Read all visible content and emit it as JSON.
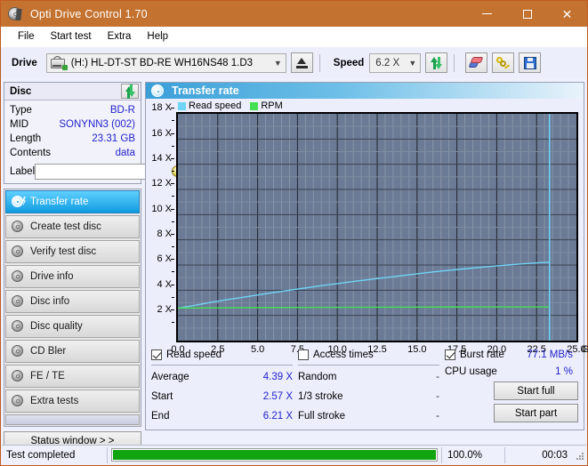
{
  "window": {
    "title": "Opti Drive Control 1.70",
    "icon": "optical-disc-icon",
    "minimize": "minimize",
    "maximize": "maximize",
    "close": "close"
  },
  "menu": {
    "items": [
      "File",
      "Start test",
      "Extra",
      "Help"
    ]
  },
  "toolbar": {
    "drive_label": "Drive",
    "drive_value": "(H:)  HL-DT-ST BD-RE  WH16NS48 1.D3",
    "eject_title": "Eject",
    "speed_label": "Speed",
    "speed_value": "6.2 X",
    "refresh_title": "Refresh",
    "erase_title": "Erase",
    "keys_title": "Keys",
    "save_title": "Save"
  },
  "disc": {
    "title": "Disc",
    "refresh_title": "Refresh disc info",
    "rows": [
      {
        "key": "Type",
        "value": "BD-R"
      },
      {
        "key": "MID",
        "value": "SONYNN3 (002)"
      },
      {
        "key": "Length",
        "value": "23.31 GB"
      },
      {
        "key": "Contents",
        "value": "data"
      }
    ],
    "label_key": "Label",
    "label_value": "",
    "label_placeholder": ""
  },
  "nav": {
    "items": [
      "Transfer rate",
      "Create test disc",
      "Verify test disc",
      "Drive info",
      "Disc info",
      "Disc quality",
      "CD Bler",
      "FE / TE",
      "Extra tests"
    ],
    "selected": 0,
    "status_window": "Status window > >"
  },
  "main": {
    "title": "Transfer rate"
  },
  "stats": {
    "read_speed": {
      "label": "Read speed",
      "checked": true
    },
    "access_times": {
      "label": "Access times",
      "checked": false
    },
    "burst_rate": {
      "label": "Burst rate",
      "checked": true,
      "value": "77.1 MB/s"
    },
    "left": [
      {
        "key": "Average",
        "value": "4.39 X"
      },
      {
        "key": "Start",
        "value": "2.57 X"
      },
      {
        "key": "End",
        "value": "6.21 X"
      }
    ],
    "middle": [
      {
        "key": "Random",
        "value": "-"
      },
      {
        "key": "1/3 stroke",
        "value": "-"
      },
      {
        "key": "Full stroke",
        "value": "-"
      }
    ],
    "cpu": {
      "key": "CPU usage",
      "value": "1 %"
    },
    "start_full": "Start full",
    "start_part": "Start part"
  },
  "statusbar": {
    "message": "Test completed",
    "progress": 100,
    "percent": "100.0%",
    "time": "00:03"
  },
  "colors": {
    "titlebar": "#c4722f",
    "read_speed": "#6fd4f5",
    "rpm": "#44e054",
    "plot_bg": "#6b7b96",
    "accent_value": "#2222cc",
    "progress": "#11a411"
  },
  "chart_data": {
    "type": "line",
    "title": "Transfer rate",
    "xlabel": "GB",
    "ylabel": "X",
    "xlim": [
      0,
      25
    ],
    "ylim": [
      0,
      18
    ],
    "xticks": [
      0.0,
      2.5,
      5.0,
      7.5,
      10.0,
      12.5,
      15.0,
      17.5,
      20.0,
      22.5,
      25.0
    ],
    "xticklabels": [
      "0.0",
      "2.5",
      "5.0",
      "7.5",
      "10.0",
      "12.5",
      "15.0",
      "17.5",
      "20.0",
      "22.5",
      "25.0"
    ],
    "x_unit_label": "GB",
    "yticks": [
      2,
      4,
      6,
      8,
      10,
      12,
      14,
      16,
      18
    ],
    "yticklabels": [
      "2 X",
      "4 X",
      "6 X",
      "8 X",
      "10 X",
      "12 X",
      "14 X",
      "16 X",
      "18 X"
    ],
    "grid": true,
    "legend": [
      "Read speed",
      "RPM"
    ],
    "legend_position": "top-left",
    "disc_end_marker_gb": 23.31,
    "series": [
      {
        "name": "Read speed",
        "color": "#6fd4f5",
        "x": [
          0.0,
          1.0,
          2.0,
          3.0,
          4.0,
          5.0,
          6.0,
          7.0,
          8.0,
          9.0,
          10.0,
          11.0,
          12.0,
          13.0,
          14.0,
          15.0,
          16.0,
          17.0,
          18.0,
          19.0,
          20.0,
          21.0,
          22.0,
          23.0,
          23.31
        ],
        "y": [
          2.57,
          2.78,
          3.02,
          3.23,
          3.42,
          3.62,
          3.82,
          4.0,
          4.18,
          4.36,
          4.52,
          4.69,
          4.85,
          5.0,
          5.15,
          5.3,
          5.45,
          5.58,
          5.7,
          5.82,
          5.93,
          6.03,
          6.13,
          6.21,
          6.21
        ]
      },
      {
        "name": "RPM",
        "color": "#44e054",
        "x": [
          0.0,
          5.0,
          10.0,
          15.0,
          20.0,
          23.31
        ],
        "y": [
          2.58,
          2.62,
          2.64,
          2.66,
          2.67,
          2.67
        ]
      }
    ],
    "summary": {
      "average": "4.39 X",
      "start": "2.57 X",
      "end": "6.21 X",
      "burst_rate": "77.1 MB/s",
      "cpu_usage": "1 %"
    }
  }
}
